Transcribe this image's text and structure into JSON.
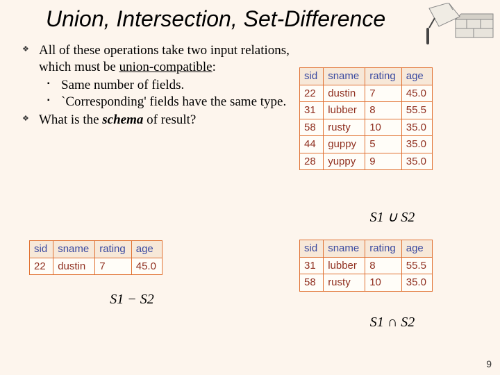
{
  "title": "Union, Intersection, Set-Difference",
  "bullets": {
    "b1_a": "All of these operations take two input relations, which must be ",
    "b1_uc": "union-compatible",
    "b1_b": ":",
    "s1": "Same number of fields.",
    "s2": "`Corresponding' fields have the same type.",
    "b2_a": "What is the ",
    "b2_schema": "schema",
    "b2_b": " of result?"
  },
  "columns": [
    "sid",
    "sname",
    "rating",
    "age"
  ],
  "union_rows": [
    [
      "22",
      "dustin",
      "7",
      "45.0"
    ],
    [
      "31",
      "lubber",
      "8",
      "55.5"
    ],
    [
      "58",
      "rusty",
      "10",
      "35.0"
    ],
    [
      "44",
      "guppy",
      "5",
      "35.0"
    ],
    [
      "28",
      "yuppy",
      "9",
      "35.0"
    ]
  ],
  "inter_rows": [
    [
      "31",
      "lubber",
      "8",
      "55.5"
    ],
    [
      "58",
      "rusty",
      "10",
      "35.0"
    ]
  ],
  "diff_rows": [
    [
      "22",
      "dustin",
      "7",
      "45.0"
    ]
  ],
  "formulas": {
    "union": "S1 ∪ S2",
    "inter": "S1 ∩ S2",
    "diff": "S1 − S2"
  },
  "page": "9"
}
